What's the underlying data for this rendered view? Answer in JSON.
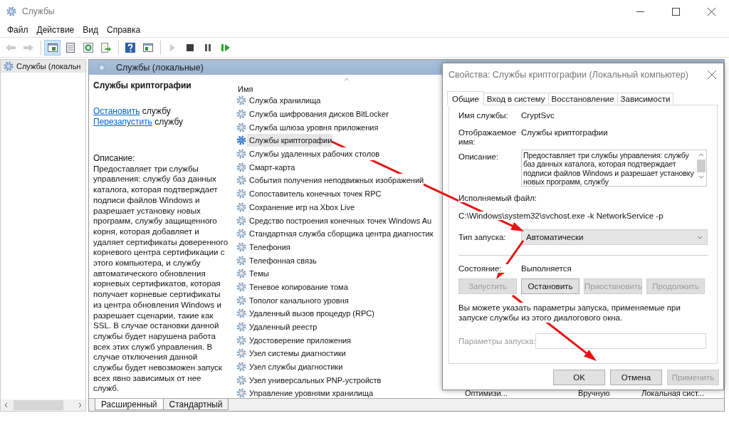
{
  "window": {
    "title": "Службы"
  },
  "menu": [
    "Файл",
    "Действие",
    "Вид",
    "Справка"
  ],
  "toolbar": [
    [
      {
        "kind": "back",
        "disabled": true,
        "pressed": false
      },
      {
        "kind": "forward",
        "disabled": true,
        "pressed": false
      }
    ],
    [
      {
        "kind": "tree",
        "disabled": false,
        "pressed": true
      },
      {
        "kind": "sheet",
        "disabled": false,
        "pressed": false
      },
      {
        "kind": "refresh",
        "disabled": false,
        "pressed": false
      },
      {
        "kind": "export",
        "disabled": false,
        "pressed": false
      }
    ],
    [
      {
        "kind": "help",
        "disabled": false,
        "pressed": false
      },
      {
        "kind": "pane",
        "disabled": false,
        "pressed": false
      }
    ],
    [
      {
        "kind": "play",
        "disabled": true,
        "pressed": false
      },
      {
        "kind": "stop",
        "disabled": false,
        "pressed": false
      },
      {
        "kind": "pause",
        "disabled": false,
        "pressed": false
      },
      {
        "kind": "resume",
        "disabled": false,
        "pressed": false
      }
    ]
  ],
  "tree": {
    "items": [
      {
        "label": "Службы (локальн",
        "selected": true
      }
    ]
  },
  "panel": {
    "title": "Службы (локальные)"
  },
  "details": {
    "title": "Службы криптографии",
    "actions": [
      {
        "link": "Остановить",
        "text": "службу"
      },
      {
        "link": "Перезапустить",
        "text": "службу"
      }
    ],
    "description_label": "Описание:",
    "description": "Предоставляет три службы управления: службу баз данных каталога, которая подтверждает подписи файлов Windows и разрешает установку новых программ, службу защищенного корня, которая добавляет и удаляет сертификаты доверенного корневого центра сертификации с этого компьютера, и службу автоматического обновления корневых сертификатов, которая получает корневые сертификаты из центра обновления Windows и разрешает сценарии, такие как SSL. В случае остановки данной службы будет нарушена работа всех этих служб управления. В случае отключения данной службы будет невозможен запуск всех явно зависимых от нее служб."
  },
  "list": {
    "columns": [
      {
        "label": "Имя"
      }
    ],
    "rows": [
      {
        "name": "Служба хранилища",
        "selected": false
      },
      {
        "name": "Служба шифрования дисков BitLocker",
        "selected": false
      },
      {
        "name": "Служба шлюза уровня приложения",
        "selected": false
      },
      {
        "name": "Службы криптографии",
        "selected": true
      },
      {
        "name": "Службы удаленных рабочих столов",
        "selected": false
      },
      {
        "name": "Смарт-карта",
        "selected": false
      },
      {
        "name": "События получения неподвижных изображений",
        "selected": false
      },
      {
        "name": "Сопоставитель конечных точек RPC",
        "selected": false
      },
      {
        "name": "Сохранение игр на Xbox Live",
        "selected": false
      },
      {
        "name": "Средство построения конечных точек Windows Au",
        "selected": false
      },
      {
        "name": "Стандартная служба сборщика центра диагностик",
        "selected": false
      },
      {
        "name": "Телефония",
        "selected": false
      },
      {
        "name": "Телефонная связь",
        "selected": false
      },
      {
        "name": "Темы",
        "selected": false
      },
      {
        "name": "Теневое копирование тома",
        "selected": false
      },
      {
        "name": "Тополог канального уровня",
        "selected": false
      },
      {
        "name": "Удаленный вызов процедур (RPC)",
        "selected": false
      },
      {
        "name": "Удаленный реестр",
        "selected": false
      },
      {
        "name": "Удостоверение приложения",
        "selected": false
      },
      {
        "name": "Узел системы диагностики",
        "selected": false
      },
      {
        "name": "Узел службы диагностики",
        "selected": false
      },
      {
        "name": "Узел универсальных PNP-устройств",
        "selected": false
      },
      {
        "name": "Управление уровнями хранилища",
        "selected": false,
        "cells": [
          "Оптимизи...",
          "Вручную",
          "Локальная сист..."
        ]
      }
    ]
  },
  "view_tabs": [
    {
      "label": "Расширенный",
      "selected": true
    },
    {
      "label": "Стандартный",
      "selected": false
    }
  ],
  "dialog": {
    "title": "Свойства: Службы криптографии (Локальный компьютер)",
    "tabs": [
      {
        "label": "Общие",
        "selected": true
      },
      {
        "label": "Вход в систему",
        "selected": false
      },
      {
        "label": "Восстановление",
        "selected": false
      },
      {
        "label": "Зависимости",
        "selected": false
      }
    ],
    "service_name": {
      "label": "Имя службы:",
      "value": "CryptSvc"
    },
    "display_name": {
      "label": "Отображаемое имя:",
      "value": "Службы криптографии"
    },
    "description": {
      "label": "Описание:",
      "value": "Предоставляет три службы управления: службу баз данных каталога, которая подтверждает подписи файлов Windows и разрешает установку новых программ, службу"
    },
    "executable": {
      "label": "Исполняемый файл:",
      "value": "C:\\Windows\\system32\\svchost.exe -k NetworkService -p"
    },
    "startup_type": {
      "label": "Тип запуска:",
      "value": "Автоматически"
    },
    "status": {
      "label": "Состояние:",
      "value": "Выполняется"
    },
    "service_buttons": [
      {
        "label": "Запустить",
        "disabled": true
      },
      {
        "label": "Остановить",
        "disabled": false
      },
      {
        "label": "Приостановить",
        "disabled": true
      },
      {
        "label": "Продолжить",
        "disabled": true
      }
    ],
    "hint": "Вы можете указать параметры запуска, применяемые при запуске службы из этого диалогового окна.",
    "start_params": {
      "label": "Параметры запуска:",
      "disabled": true
    },
    "buttons": [
      {
        "label": "OK",
        "disabled": false
      },
      {
        "label": "Отмена",
        "disabled": false
      },
      {
        "label": "Применить",
        "disabled": true
      }
    ]
  }
}
